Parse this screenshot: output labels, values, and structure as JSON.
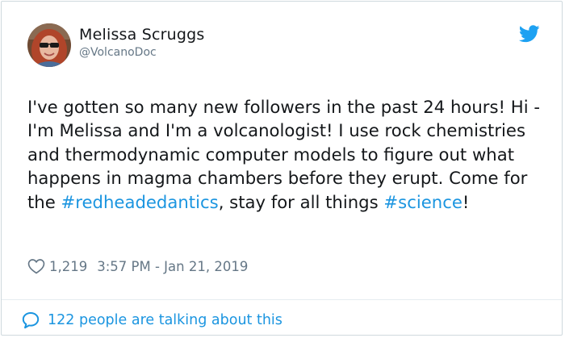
{
  "author": {
    "name": "Melissa Scruggs",
    "handle": "@VolcanoDoc"
  },
  "tweet": {
    "text_1": "I've gotten so many new followers in the past 24 hours! Hi - I'm Melissa and I'm a volcanologist! I use rock chemistries and thermodynamic computer models to figure out what happens in magma chambers before they erupt. Come for the ",
    "hashtag_1": "#redheadedantics",
    "text_2": ", stay for all things ",
    "hashtag_2": "#science",
    "text_3": "!"
  },
  "meta": {
    "likes": "1,219",
    "timestamp": "3:57 PM - Jan 21, 2019"
  },
  "footer": {
    "conversation": "122 people are talking about this"
  },
  "icons": {
    "logo": "twitter-bird-icon",
    "like": "heart-icon",
    "reply": "speech-bubble-icon"
  },
  "colors": {
    "brand_blue": "#1da1f2",
    "link_blue": "#1b95e0",
    "muted_gray": "#657786",
    "text_dark": "#14171a",
    "border": "#cfd9de"
  }
}
